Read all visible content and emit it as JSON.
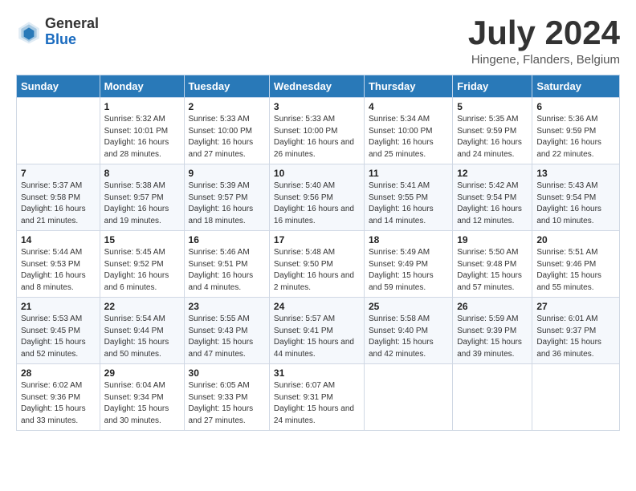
{
  "header": {
    "logo_general": "General",
    "logo_blue": "Blue",
    "month_title": "July 2024",
    "location": "Hingene, Flanders, Belgium"
  },
  "weekdays": [
    "Sunday",
    "Monday",
    "Tuesday",
    "Wednesday",
    "Thursday",
    "Friday",
    "Saturday"
  ],
  "weeks": [
    [
      {
        "day": "",
        "sunrise": "",
        "sunset": "",
        "daylight": ""
      },
      {
        "day": "1",
        "sunrise": "Sunrise: 5:32 AM",
        "sunset": "Sunset: 10:01 PM",
        "daylight": "Daylight: 16 hours and 28 minutes."
      },
      {
        "day": "2",
        "sunrise": "Sunrise: 5:33 AM",
        "sunset": "Sunset: 10:00 PM",
        "daylight": "Daylight: 16 hours and 27 minutes."
      },
      {
        "day": "3",
        "sunrise": "Sunrise: 5:33 AM",
        "sunset": "Sunset: 10:00 PM",
        "daylight": "Daylight: 16 hours and 26 minutes."
      },
      {
        "day": "4",
        "sunrise": "Sunrise: 5:34 AM",
        "sunset": "Sunset: 10:00 PM",
        "daylight": "Daylight: 16 hours and 25 minutes."
      },
      {
        "day": "5",
        "sunrise": "Sunrise: 5:35 AM",
        "sunset": "Sunset: 9:59 PM",
        "daylight": "Daylight: 16 hours and 24 minutes."
      },
      {
        "day": "6",
        "sunrise": "Sunrise: 5:36 AM",
        "sunset": "Sunset: 9:59 PM",
        "daylight": "Daylight: 16 hours and 22 minutes."
      }
    ],
    [
      {
        "day": "7",
        "sunrise": "Sunrise: 5:37 AM",
        "sunset": "Sunset: 9:58 PM",
        "daylight": "Daylight: 16 hours and 21 minutes."
      },
      {
        "day": "8",
        "sunrise": "Sunrise: 5:38 AM",
        "sunset": "Sunset: 9:57 PM",
        "daylight": "Daylight: 16 hours and 19 minutes."
      },
      {
        "day": "9",
        "sunrise": "Sunrise: 5:39 AM",
        "sunset": "Sunset: 9:57 PM",
        "daylight": "Daylight: 16 hours and 18 minutes."
      },
      {
        "day": "10",
        "sunrise": "Sunrise: 5:40 AM",
        "sunset": "Sunset: 9:56 PM",
        "daylight": "Daylight: 16 hours and 16 minutes."
      },
      {
        "day": "11",
        "sunrise": "Sunrise: 5:41 AM",
        "sunset": "Sunset: 9:55 PM",
        "daylight": "Daylight: 16 hours and 14 minutes."
      },
      {
        "day": "12",
        "sunrise": "Sunrise: 5:42 AM",
        "sunset": "Sunset: 9:54 PM",
        "daylight": "Daylight: 16 hours and 12 minutes."
      },
      {
        "day": "13",
        "sunrise": "Sunrise: 5:43 AM",
        "sunset": "Sunset: 9:54 PM",
        "daylight": "Daylight: 16 hours and 10 minutes."
      }
    ],
    [
      {
        "day": "14",
        "sunrise": "Sunrise: 5:44 AM",
        "sunset": "Sunset: 9:53 PM",
        "daylight": "Daylight: 16 hours and 8 minutes."
      },
      {
        "day": "15",
        "sunrise": "Sunrise: 5:45 AM",
        "sunset": "Sunset: 9:52 PM",
        "daylight": "Daylight: 16 hours and 6 minutes."
      },
      {
        "day": "16",
        "sunrise": "Sunrise: 5:46 AM",
        "sunset": "Sunset: 9:51 PM",
        "daylight": "Daylight: 16 hours and 4 minutes."
      },
      {
        "day": "17",
        "sunrise": "Sunrise: 5:48 AM",
        "sunset": "Sunset: 9:50 PM",
        "daylight": "Daylight: 16 hours and 2 minutes."
      },
      {
        "day": "18",
        "sunrise": "Sunrise: 5:49 AM",
        "sunset": "Sunset: 9:49 PM",
        "daylight": "Daylight: 15 hours and 59 minutes."
      },
      {
        "day": "19",
        "sunrise": "Sunrise: 5:50 AM",
        "sunset": "Sunset: 9:48 PM",
        "daylight": "Daylight: 15 hours and 57 minutes."
      },
      {
        "day": "20",
        "sunrise": "Sunrise: 5:51 AM",
        "sunset": "Sunset: 9:46 PM",
        "daylight": "Daylight: 15 hours and 55 minutes."
      }
    ],
    [
      {
        "day": "21",
        "sunrise": "Sunrise: 5:53 AM",
        "sunset": "Sunset: 9:45 PM",
        "daylight": "Daylight: 15 hours and 52 minutes."
      },
      {
        "day": "22",
        "sunrise": "Sunrise: 5:54 AM",
        "sunset": "Sunset: 9:44 PM",
        "daylight": "Daylight: 15 hours and 50 minutes."
      },
      {
        "day": "23",
        "sunrise": "Sunrise: 5:55 AM",
        "sunset": "Sunset: 9:43 PM",
        "daylight": "Daylight: 15 hours and 47 minutes."
      },
      {
        "day": "24",
        "sunrise": "Sunrise: 5:57 AM",
        "sunset": "Sunset: 9:41 PM",
        "daylight": "Daylight: 15 hours and 44 minutes."
      },
      {
        "day": "25",
        "sunrise": "Sunrise: 5:58 AM",
        "sunset": "Sunset: 9:40 PM",
        "daylight": "Daylight: 15 hours and 42 minutes."
      },
      {
        "day": "26",
        "sunrise": "Sunrise: 5:59 AM",
        "sunset": "Sunset: 9:39 PM",
        "daylight": "Daylight: 15 hours and 39 minutes."
      },
      {
        "day": "27",
        "sunrise": "Sunrise: 6:01 AM",
        "sunset": "Sunset: 9:37 PM",
        "daylight": "Daylight: 15 hours and 36 minutes."
      }
    ],
    [
      {
        "day": "28",
        "sunrise": "Sunrise: 6:02 AM",
        "sunset": "Sunset: 9:36 PM",
        "daylight": "Daylight: 15 hours and 33 minutes."
      },
      {
        "day": "29",
        "sunrise": "Sunrise: 6:04 AM",
        "sunset": "Sunset: 9:34 PM",
        "daylight": "Daylight: 15 hours and 30 minutes."
      },
      {
        "day": "30",
        "sunrise": "Sunrise: 6:05 AM",
        "sunset": "Sunset: 9:33 PM",
        "daylight": "Daylight: 15 hours and 27 minutes."
      },
      {
        "day": "31",
        "sunrise": "Sunrise: 6:07 AM",
        "sunset": "Sunset: 9:31 PM",
        "daylight": "Daylight: 15 hours and 24 minutes."
      },
      {
        "day": "",
        "sunrise": "",
        "sunset": "",
        "daylight": ""
      },
      {
        "day": "",
        "sunrise": "",
        "sunset": "",
        "daylight": ""
      },
      {
        "day": "",
        "sunrise": "",
        "sunset": "",
        "daylight": ""
      }
    ]
  ]
}
